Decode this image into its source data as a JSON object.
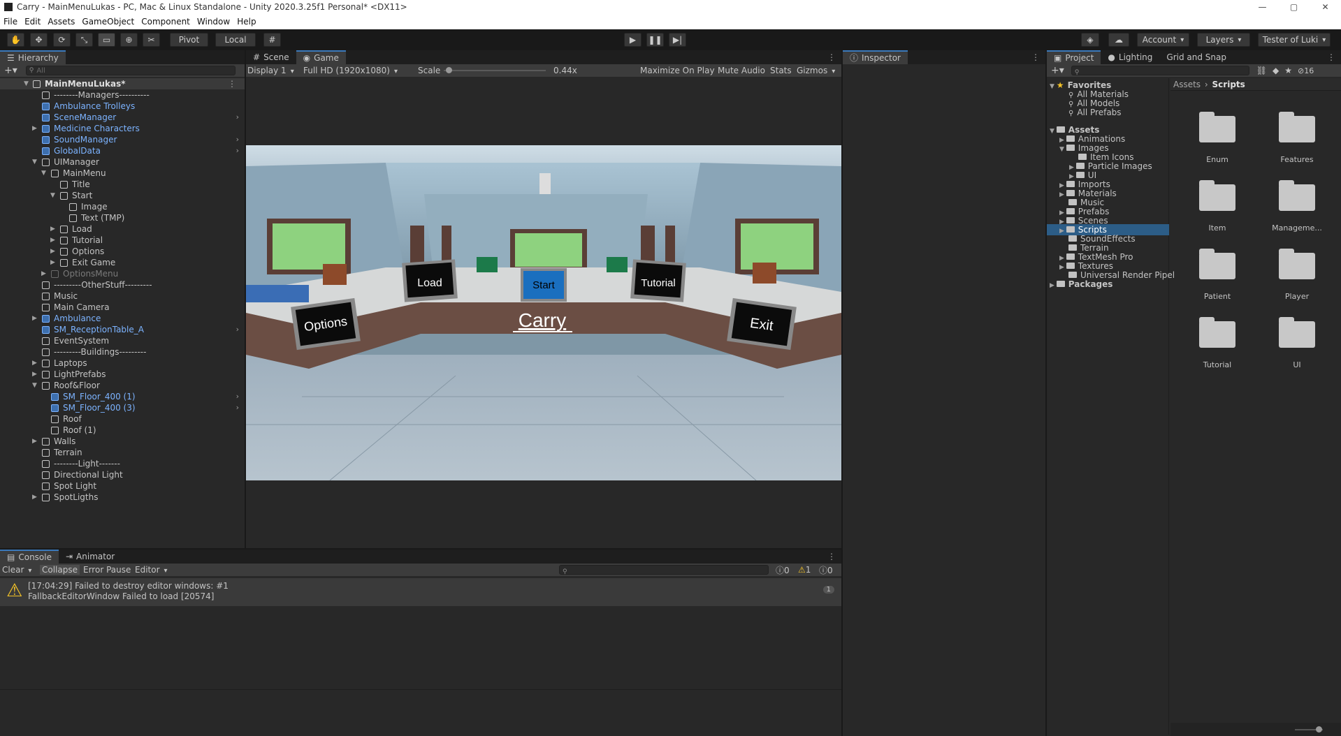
{
  "window": {
    "title": "Carry - MainMenuLukas - PC, Mac & Linux Standalone - Unity 2020.3.25f1 Personal* <DX11>",
    "minimize": "—",
    "maximize": "▢",
    "close": "✕"
  },
  "menu": [
    "File",
    "Edit",
    "Assets",
    "GameObject",
    "Component",
    "Window",
    "Help"
  ],
  "toolbar": {
    "pivot": "Pivot",
    "local": "Local",
    "account": "Account",
    "layers": "Layers",
    "user": "Tester of Luki"
  },
  "hierarchy": {
    "tab": "Hierarchy",
    "search_placeholder": "All",
    "scene": "MainMenuLukas*",
    "items": [
      {
        "label": "--------Managers----------"
      },
      {
        "label": "Ambulance Trolleys"
      },
      {
        "label": "SceneManager"
      },
      {
        "label": "Medicine Characters"
      },
      {
        "label": "SoundManager"
      },
      {
        "label": "GlobalData"
      },
      {
        "label": "UIManager"
      },
      {
        "label": "MainMenu"
      },
      {
        "label": "Title"
      },
      {
        "label": "Start"
      },
      {
        "label": "Image"
      },
      {
        "label": "Text (TMP)"
      },
      {
        "label": "Load"
      },
      {
        "label": "Tutorial"
      },
      {
        "label": "Options"
      },
      {
        "label": "Exit Game"
      },
      {
        "label": "OptionsMenu"
      },
      {
        "label": "---------OtherStuff---------"
      },
      {
        "label": "Music"
      },
      {
        "label": "Main Camera"
      },
      {
        "label": "Ambulance"
      },
      {
        "label": "SM_ReceptionTable_A"
      },
      {
        "label": "EventSystem"
      },
      {
        "label": "---------Buildings---------"
      },
      {
        "label": "Laptops"
      },
      {
        "label": "LightPrefabs"
      },
      {
        "label": "Roof&Floor"
      },
      {
        "label": "SM_Floor_400 (1)"
      },
      {
        "label": "SM_Floor_400 (3)"
      },
      {
        "label": "Roof"
      },
      {
        "label": "Roof (1)"
      },
      {
        "label": "Walls"
      },
      {
        "label": "Terrain"
      },
      {
        "label": "--------Light-------"
      },
      {
        "label": "Directional Light"
      },
      {
        "label": "Spot Light"
      },
      {
        "label": "SpotLigths"
      }
    ]
  },
  "scene_tabs": {
    "scene": "Scene",
    "game": "Game"
  },
  "game_bar": {
    "display": "Display 1",
    "resolution": "Full HD (1920x1080)",
    "scale_label": "Scale",
    "scale_value": "0.44x",
    "scale_fraction": 0.02,
    "maximize": "Maximize On Play",
    "mute": "Mute Audio",
    "stats": "Stats",
    "gizmos": "Gizmos"
  },
  "game": {
    "title": "Carry",
    "buttons": {
      "load": "Load",
      "start": "Start",
      "tutorial": "Tutorial",
      "options": "Options",
      "exit": "Exit"
    }
  },
  "inspector": {
    "tab": "Inspector"
  },
  "project": {
    "tabs": [
      "Project",
      "Lighting",
      "Grid and Snap"
    ],
    "hidden_count": "16",
    "favorites_label": "Favorites",
    "favorites": [
      "All Materials",
      "All Models",
      "All Prefabs"
    ],
    "assets_label": "Assets",
    "tree": [
      "Animations",
      "Images",
      "Item Icons",
      "Particle Images",
      "UI",
      "Imports",
      "Materials",
      "Music",
      "Prefabs",
      "Scenes",
      "Scripts",
      "SoundEffects",
      "Terrain",
      "TextMesh Pro",
      "Textures",
      "Universal Render Pipel"
    ],
    "packages_label": "Packages",
    "breadcrumb": {
      "root": "Assets",
      "current": "Scripts"
    },
    "folders": [
      "Enum",
      "Features",
      "Item",
      "Manageme...",
      "Patient",
      "Player",
      "Tutorial",
      "UI"
    ]
  },
  "console": {
    "tabs": {
      "console": "Console",
      "animator": "Animator"
    },
    "clear": "Clear",
    "collapse": "Collapse",
    "error_pause": "Error Pause",
    "editor": "Editor",
    "counts": {
      "info": "0",
      "warn": "1",
      "error": "0"
    },
    "message_line1": "[17:04:29] Failed to destroy editor windows: #1",
    "message_line2": "FallbackEditorWindow  Failed to load [20574]",
    "message_count": "1"
  },
  "colors": {
    "accent": "#3a79bb",
    "prefab_blue": "#7cb3ff",
    "selection": "#2c5d87",
    "warning": "#f4c328"
  }
}
